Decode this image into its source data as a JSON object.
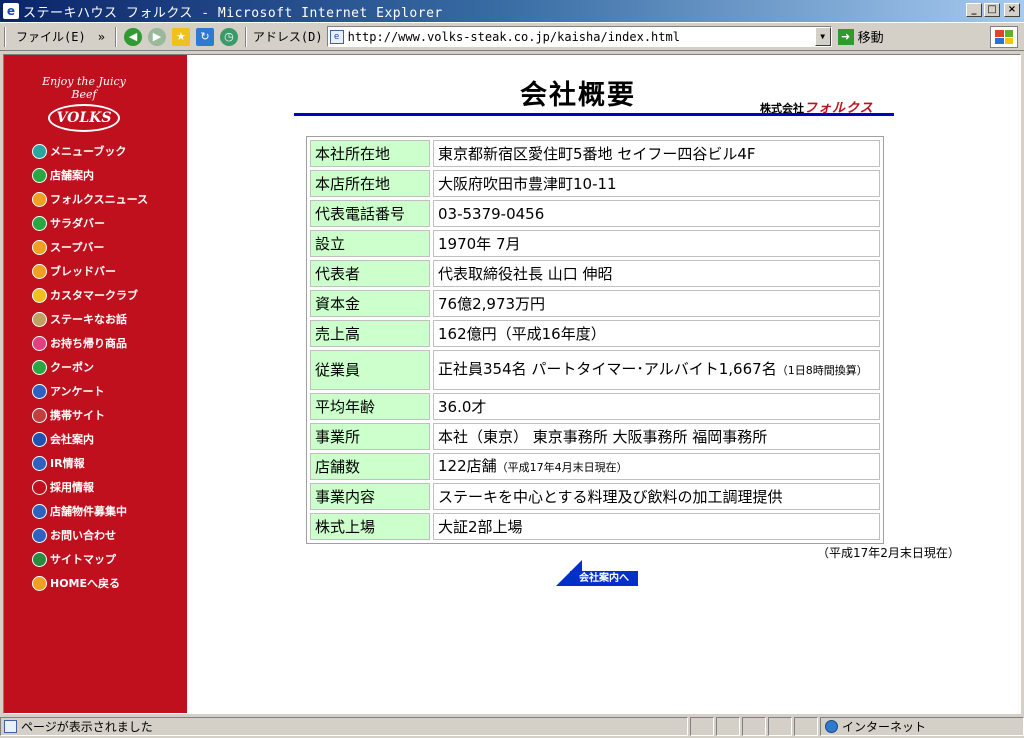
{
  "window": {
    "title": "ステーキハウス フォルクス - Microsoft Internet Explorer"
  },
  "toolbar": {
    "file_menu": "ファイル(E)",
    "chevron": "»",
    "address_label": "アドレス(D)",
    "url": "http://www.volks-steak.co.jp/kaisha/index.html",
    "go_label": "移動"
  },
  "sidebar": {
    "tagline": "Enjoy the Juicy Beef",
    "logo": "VOLKS",
    "items": [
      {
        "label": "メニューブック",
        "color": "#2aa6a0",
        "icon": "book-icon"
      },
      {
        "label": "店舗案内",
        "color": "#2aa642",
        "icon": "store-icon"
      },
      {
        "label": "フォルクスニュース",
        "color": "#f0a020",
        "icon": "news-icon"
      },
      {
        "label": "サラダバー",
        "color": "#2aa642",
        "icon": "salad-icon"
      },
      {
        "label": "スープバー",
        "color": "#f0a020",
        "icon": "soup-icon"
      },
      {
        "label": "ブレッドバー",
        "color": "#f0a020",
        "icon": "bread-icon"
      },
      {
        "label": "カスタマークラブ",
        "color": "#f0c020",
        "icon": "club-icon"
      },
      {
        "label": "ステーキなお話",
        "color": "#c0a060",
        "icon": "steak-icon"
      },
      {
        "label": "お持ち帰り商品",
        "color": "#e04080",
        "icon": "takeout-icon"
      },
      {
        "label": "クーポン",
        "color": "#2aa642",
        "icon": "coupon-icon"
      },
      {
        "label": "アンケート",
        "color": "#3060c0",
        "icon": "survey-icon"
      },
      {
        "label": "携帯サイト",
        "color": "#c04040",
        "icon": "mobile-icon"
      },
      {
        "label": "会社案内",
        "color": "#2050b0",
        "icon": "company-icon"
      },
      {
        "label": "IR情報",
        "color": "#3060c0",
        "icon": "ir-icon"
      },
      {
        "label": "採用情報",
        "color": "#c01020",
        "icon": "recruit-icon"
      },
      {
        "label": "店舗物件募集中",
        "color": "#3060c0",
        "icon": "property-icon"
      },
      {
        "label": "お問い合わせ",
        "color": "#3060c0",
        "icon": "mail-icon"
      },
      {
        "label": "サイトマップ",
        "color": "#2a8a40",
        "icon": "globe-icon"
      },
      {
        "label": "HOMEへ戻る",
        "color": "#f0a020",
        "icon": "home-icon"
      }
    ]
  },
  "page": {
    "title": "会社概要",
    "company_prefix": "株式会社",
    "company_brand": "フォルクス",
    "rows": [
      {
        "key": "本社所在地",
        "value": "東京都新宿区愛住町5番地 セイフー四谷ビル4F"
      },
      {
        "key": "本店所在地",
        "value": "大阪府吹田市豊津町10-11"
      },
      {
        "key": "代表電話番号",
        "value": "03-5379-0456"
      },
      {
        "key": "設立",
        "value": "1970年 7月"
      },
      {
        "key": "代表者",
        "value": "代表取締役社長  山口 伸昭"
      },
      {
        "key": "資本金",
        "value": "76億2,973万円"
      },
      {
        "key": "売上高",
        "value": "162億円（平成16年度）"
      },
      {
        "key": "従業員",
        "value": "正社員354名 パートタイマー･アルバイト1,667名",
        "note": "（1日8時間換算）"
      },
      {
        "key": "平均年齢",
        "value": "36.0才"
      },
      {
        "key": "事業所",
        "value": "本社（東京）   東京事務所   大阪事務所   福岡事務所"
      },
      {
        "key": "店舗数",
        "value": "122店舗",
        "note": "（平成17年4月末日現在）"
      },
      {
        "key": "事業内容",
        "value": "ステーキを中心とする料理及び飲料の加工調理提供"
      },
      {
        "key": "株式上場",
        "value": "大証2部上場"
      }
    ],
    "as_of": "（平成17年2月末日現在）",
    "back_link": "会社案内へ"
  },
  "status": {
    "text": "ページが表示されました",
    "zone": "インターネット"
  }
}
